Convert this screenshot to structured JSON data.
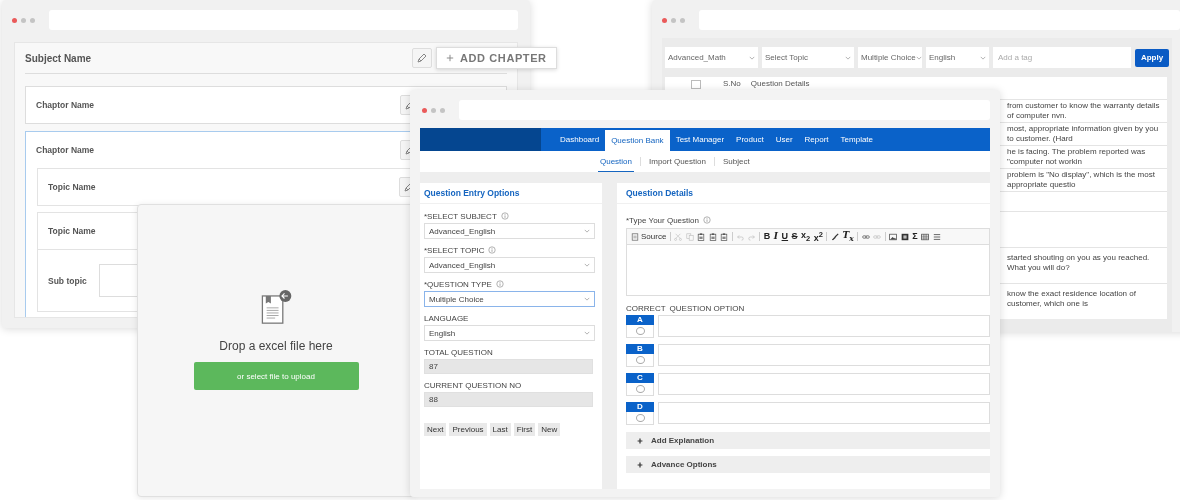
{
  "subject_window": {
    "subject": "Subject Name",
    "add_button": "ADD CHAPTER",
    "chapters": [
      {
        "name": "Chaptor Name",
        "expanded": false
      },
      {
        "name": "Chaptor Name",
        "expanded": true,
        "topics": [
          {
            "name": "Topic Name"
          },
          {
            "name": "Topic Name",
            "subtopic_label": "Sub topic"
          }
        ]
      }
    ]
  },
  "upload_panel": {
    "message": "Drop a excel file here",
    "button": "or select file to upload"
  },
  "question_list_window": {
    "filters": [
      "Advanced_Math",
      "Select Topic",
      "Multiple Choice",
      "English"
    ],
    "tag_placeholder": "Add a tag",
    "apply": "Apply",
    "columns": [
      "S.No",
      "Question Details"
    ],
    "select_all_checked": false,
    "rows": [
      {
        "kind": "short",
        "text": "from customer to know the warranty details of computer nvn."
      },
      {
        "kind": "short",
        "text": "most, appropriate information given by you to customer. (Hard"
      },
      {
        "kind": "short",
        "text": "he is facing. The problem reported was \"computer not workin"
      },
      {
        "kind": "short",
        "text": "problem is \"No display\", which is the most appropriate questio"
      },
      {
        "kind": "short"
      },
      {
        "kind": "tall"
      },
      {
        "kind": "tall",
        "text": "started shouting on you as you reached. What you will do?"
      },
      {
        "kind": "tall",
        "text": "know the exact residence location of customer, which one is"
      }
    ]
  },
  "question_window": {
    "nav": [
      {
        "label": "Dashboard",
        "selected": false
      },
      {
        "label": "Question Bank",
        "selected": true
      },
      {
        "label": "Test Manager",
        "selected": false
      },
      {
        "label": "Product",
        "selected": false
      },
      {
        "label": "User",
        "selected": false
      },
      {
        "label": "Report",
        "selected": false
      },
      {
        "label": "Template",
        "selected": false
      }
    ],
    "subnav": [
      {
        "label": "Question",
        "selected": true
      },
      {
        "label": "Import Question",
        "selected": false
      },
      {
        "label": "Subject",
        "selected": false
      }
    ],
    "entry_options": {
      "title": "Question Entry Options",
      "fields": [
        {
          "kind": "select",
          "label": "*SELECT SUBJECT",
          "info": true,
          "value": "Advanced_English",
          "focused": false
        },
        {
          "kind": "select",
          "label": "*SELECT TOPIC",
          "info": true,
          "value": "Advanced_English",
          "focused": false
        },
        {
          "kind": "select",
          "label": "*QUESTION TYPE",
          "info": true,
          "value": "Multiple Choice",
          "focused": true
        },
        {
          "kind": "select",
          "label": "LANGUAGE",
          "info": false,
          "value": "English",
          "focused": false
        },
        {
          "kind": "readonly",
          "label": "TOTAL QUESTION",
          "info": false,
          "value": "87",
          "focused": false
        },
        {
          "kind": "readonly",
          "label": "CURRENT QUESTION NO",
          "info": false,
          "value": "88",
          "focused": false
        }
      ],
      "buttons": [
        "Next",
        "Previous",
        "Last",
        "First",
        "New"
      ]
    },
    "details": {
      "title": "Question Details",
      "question_label": "*Type Your Question",
      "toolbar": [
        [
          {
            "kind": "source",
            "label": "Source",
            "disabled": false
          }
        ],
        [
          {
            "kind": "cut",
            "disabled": true
          },
          {
            "kind": "copy",
            "disabled": true
          },
          {
            "kind": "paste",
            "disabled": false
          },
          {
            "kind": "paste",
            "disabled": false
          },
          {
            "kind": "paste",
            "disabled": false
          }
        ],
        [
          {
            "kind": "undo",
            "disabled": true
          },
          {
            "kind": "redo",
            "disabled": true
          }
        ],
        [
          {
            "kind": "bold",
            "label": "B",
            "disabled": false
          },
          {
            "kind": "italic",
            "label": "I",
            "disabled": false
          },
          {
            "kind": "underline",
            "label": "U",
            "disabled": false
          },
          {
            "kind": "strike",
            "label": "S",
            "disabled": false
          },
          {
            "kind": "text",
            "label": "x$_{2}$",
            "disabled": false
          },
          {
            "kind": "text",
            "label": "x$^{2}$",
            "disabled": false
          }
        ],
        [
          {
            "kind": "brush",
            "disabled": false
          },
          {
            "kind": "italic",
            "label": "T$_{x}$",
            "disabled": false
          }
        ],
        [
          {
            "kind": "link",
            "disabled": false
          },
          {
            "kind": "link",
            "disabled": true
          }
        ],
        [
          {
            "kind": "image",
            "disabled": false
          },
          {
            "kind": "media",
            "disabled": false
          },
          {
            "kind": "text",
            "label": "Σ",
            "disabled": false
          },
          {
            "kind": "table",
            "disabled": false
          },
          {
            "kind": "hr",
            "disabled": false
          }
        ]
      ],
      "correct_label": "CORRECT",
      "option_label": "QUESTION OPTION",
      "options": [
        {
          "letter": "A",
          "selected": false
        },
        {
          "letter": "B",
          "selected": false
        },
        {
          "letter": "C",
          "selected": false
        },
        {
          "letter": "D",
          "selected": false
        }
      ],
      "sections": [
        "Add Explanation",
        "Advance Options"
      ]
    }
  }
}
